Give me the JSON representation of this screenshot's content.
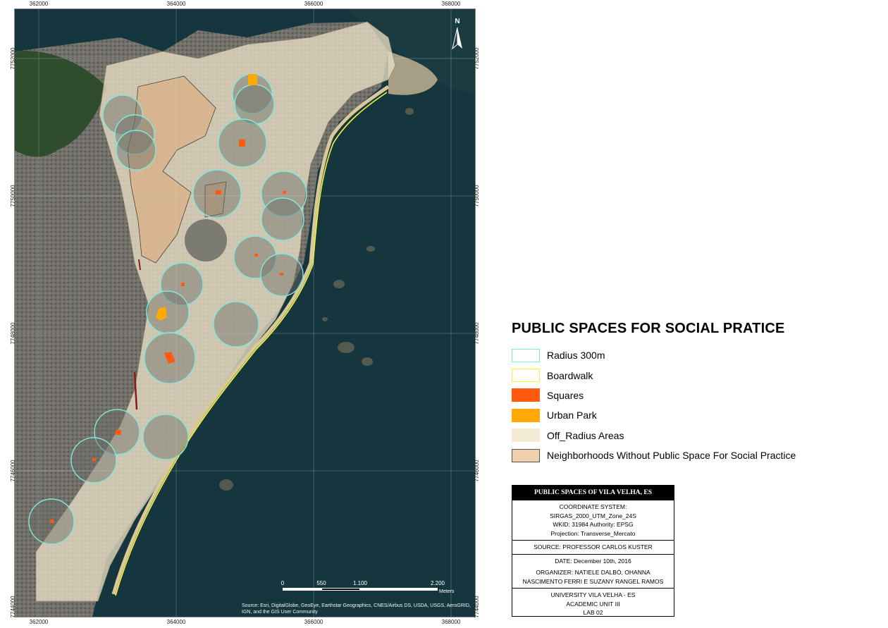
{
  "map": {
    "x_ticks": [
      "362000",
      "364000",
      "366000",
      "368000"
    ],
    "y_ticks": [
      "7752000",
      "7750000",
      "7748000",
      "7746000",
      "7744000"
    ],
    "north_label": "N",
    "scale": {
      "labels": [
        "0",
        "550",
        "1.100",
        "2.200"
      ],
      "unit": "Meters"
    },
    "attribution": "Source: Esri, DigitalGlobe, GeoEye, Earthstar Geographics, CNES/Airbus DS, USDA, USGS, AeroGRID, IGN, and the GIS User Community"
  },
  "legend": {
    "title": "PUBLIC SPACES FOR SOCIAL PRATICE",
    "items": [
      {
        "label": "Radius 300m",
        "fill": "#ffffff",
        "stroke": "#7fe8e0"
      },
      {
        "label": "Boardwalk",
        "fill": "#ffffff",
        "stroke": "#f5f538"
      },
      {
        "label": "Squares",
        "fill": "#ff5a0f",
        "stroke": "#ff5a0f"
      },
      {
        "label": "Urban Park",
        "fill": "#ffaa00",
        "stroke": "#ffaa00"
      },
      {
        "label": "Off_Radius Areas",
        "fill": "#f4ebd6",
        "stroke": "#f4ebd6"
      },
      {
        "label": "Neighborhoods Without Public Space For Social Practice",
        "fill": "#f0cfad",
        "stroke": "#555555"
      }
    ]
  },
  "info": {
    "header": "PUBLIC SPACES OF VILA VELHA, ES",
    "coord": [
      "COORDINATE SYSTEM:",
      "SIRGAS_2000_UTM_Zone_24S",
      "WKID: 31984 Authority: EPSG",
      "Projection: Transverse_Mercato"
    ],
    "source": "SOURCE: PROFESSOR CARLOS KUSTER",
    "date": "DATE: December 10th, 2016",
    "organizer": [
      "ORGANIZER: NATIELE DALBÓ, OHANNA",
      "NASCIMENTO FERRI E SUZANY RANGEL RAMOS"
    ],
    "university": [
      "UNIVERSITY VILA VELHA - ES",
      "ACADEMIC UNIT III",
      "LAB 02"
    ]
  },
  "colors": {
    "sea": "#14333f",
    "urban": "#6e6f6c",
    "forest": "#2e4a2c",
    "off_radius": "#e9dfc4",
    "neighborhood": "#d9b48e",
    "radius": "#7fe8e0",
    "boardwalk": "#f5f538",
    "square": "#ff5a0f",
    "park": "#ffaa00"
  }
}
